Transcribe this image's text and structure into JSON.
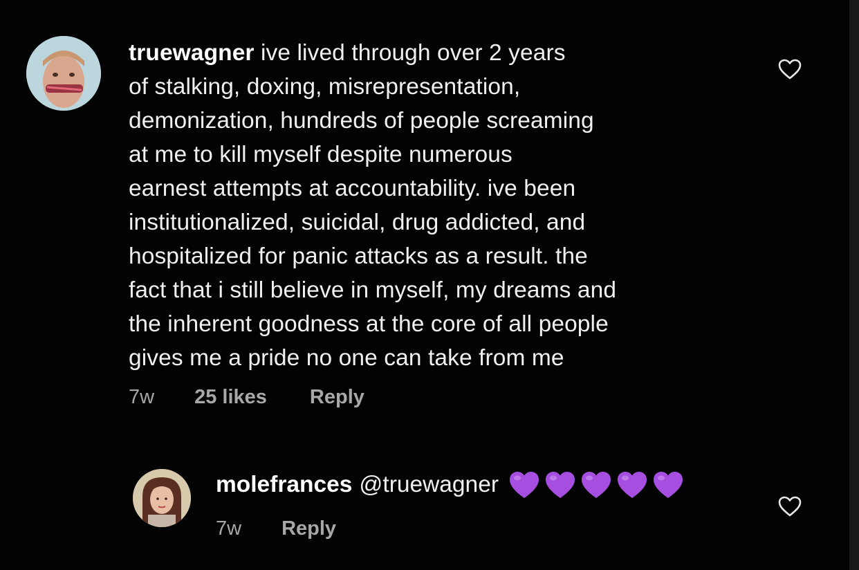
{
  "comments": [
    {
      "username": "truewagner",
      "lines": [
        " ive lived through over 2 years",
        "of stalking, doxing, misrepresentation,",
        "demonization, hundreds of people screaming",
        "at me to kill myself despite numerous",
        "earnest attempts at accountability. ive been",
        "institutionalized, suicidal, drug addicted, and",
        "hospitalized for panic attacks as a result. the",
        "fact that i still believe in myself, my dreams and",
        "the inherent goodness at the core of all people",
        "gives me a pride no one can take from me"
      ],
      "time": "7w",
      "likes": "25 likes",
      "reply_label": "Reply",
      "avatar_icon": "user-avatar-icon",
      "like_icon": "heart-outline-icon"
    },
    {
      "username": "molefrances",
      "mention": "@truewagner",
      "emoji": [
        "💜",
        "💜",
        "💜",
        "💜",
        "💜"
      ],
      "time": "7w",
      "reply_label": "Reply",
      "avatar_icon": "user-avatar-icon",
      "like_icon": "heart-outline-icon"
    }
  ],
  "colors": {
    "background": "#030303",
    "text": "#f0f0f0",
    "meta": "#a8a8a8",
    "emoji_purple": "#a64ee0"
  }
}
